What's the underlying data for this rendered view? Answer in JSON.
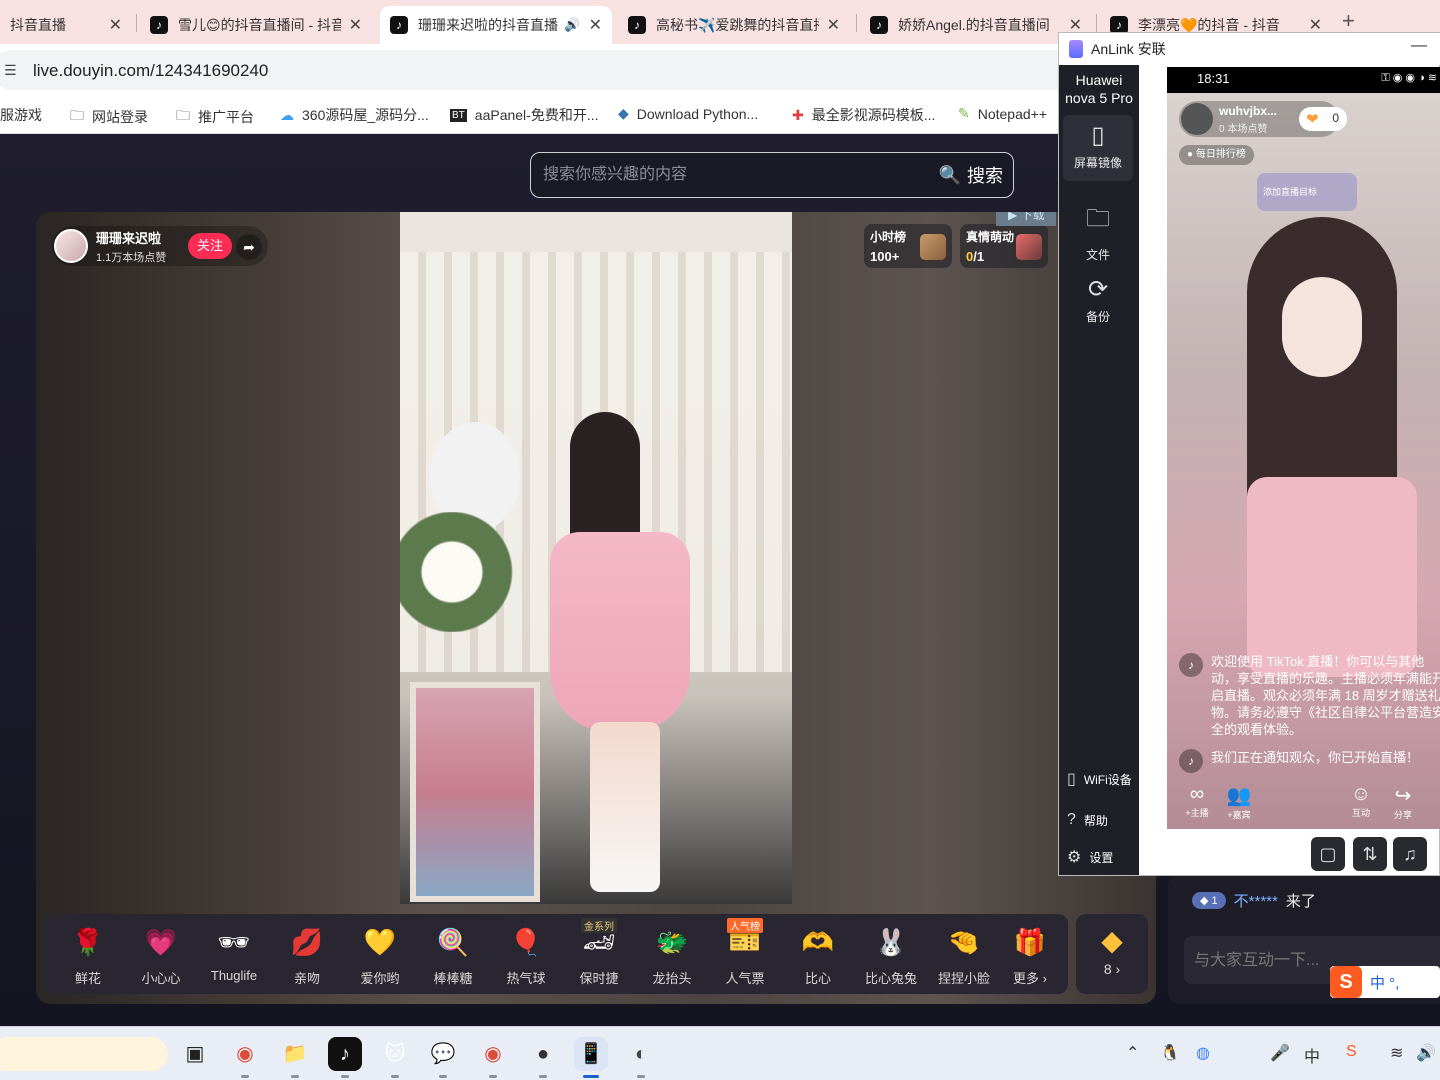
{
  "browser": {
    "tabs": [
      {
        "title": "抖音直播",
        "active": false
      },
      {
        "title": "雪儿😊的抖音直播间 - 抖音",
        "active": false
      },
      {
        "title": "珊珊来迟啦的抖音直播",
        "active": true
      },
      {
        "title": "高秘书✈️爱跳舞的抖音直播",
        "active": false
      },
      {
        "title": "娇娇Angel.的抖音直播间",
        "active": false
      },
      {
        "title": "李漂亮🧡的抖音 - 抖音",
        "active": false
      }
    ],
    "url": "live.douyin.com/124341690240",
    "bookmarks": [
      {
        "label": "服游戏",
        "icon": "folder-icon"
      },
      {
        "label": "网站登录",
        "icon": "folder-icon"
      },
      {
        "label": "推广平台",
        "icon": "folder-icon"
      },
      {
        "label": "360源码屋_源码分...",
        "icon": "cloud-icon"
      },
      {
        "label": "aaPanel-免费和开...",
        "icon": "bt-icon"
      },
      {
        "label": "Download Python...",
        "icon": "python-icon"
      },
      {
        "label": "最全影视源码模板...",
        "icon": "puzzle-icon"
      },
      {
        "label": "Notepad++",
        "icon": "notepad-icon"
      }
    ]
  },
  "search": {
    "placeholder": "搜索你感兴趣的内容",
    "button_label": "搜索"
  },
  "live": {
    "streamer_name": "珊珊来迟啦",
    "streamer_likes": "1.1万本场点赞",
    "follow_label": "关注",
    "hourly_rank_title": "小时榜",
    "hourly_rank_value": "100+",
    "ranking_title": "真情萌动",
    "ranking_value_hl": "0",
    "ranking_value_rest": "/1",
    "download_label": "下载"
  },
  "gifts": [
    {
      "label": "鲜花",
      "icon": "🌹",
      "badge": ""
    },
    {
      "label": "小心心",
      "icon": "💗",
      "badge": ""
    },
    {
      "label": "Thuglife",
      "icon": "🕶",
      "badge": ""
    },
    {
      "label": "亲吻",
      "icon": "💋",
      "badge": ""
    },
    {
      "label": "爱你哟",
      "icon": "💛",
      "badge": ""
    },
    {
      "label": "棒棒糖",
      "icon": "🍭",
      "badge": ""
    },
    {
      "label": "热气球",
      "icon": "🎈",
      "badge": ""
    },
    {
      "label": "保时捷",
      "icon": "🏎",
      "badge": "金系列"
    },
    {
      "label": "龙抬头",
      "icon": "🐲",
      "badge": ""
    },
    {
      "label": "人气票",
      "icon": "🎫",
      "badge": "人气榜"
    },
    {
      "label": "比心",
      "icon": "🫶",
      "badge": ""
    },
    {
      "label": "比心兔兔",
      "icon": "🐰",
      "badge": ""
    },
    {
      "label": "捏捏小脸",
      "icon": "🤏",
      "badge": ""
    },
    {
      "label": "更多 ›",
      "icon": "🎁",
      "badge": ""
    }
  ],
  "diamond": {
    "count": "8 ›"
  },
  "chat": {
    "level": "1",
    "user": "不*****",
    "text": "来了",
    "placeholder": "与大家互动一下..."
  },
  "ime": {
    "text": "中 °,"
  },
  "anlink": {
    "title": "AnLink 安联",
    "device_name_line1": "Huawei",
    "device_name_line2": "nova 5 Pro",
    "side_items": [
      {
        "label": "屏幕镜像",
        "icon": "phone-icon"
      },
      {
        "label": "文件",
        "icon": "folder-icon"
      },
      {
        "label": "备份",
        "icon": "sync-icon"
      }
    ],
    "bottom_items": [
      {
        "label": "WiFi设备",
        "icon": "wifi-device-icon"
      },
      {
        "label": "帮助",
        "icon": "help-icon"
      },
      {
        "label": "设置",
        "icon": "gear-icon"
      }
    ],
    "phone": {
      "time": "18:31",
      "user": "wuhvjbx...",
      "likes": "0 本场点赞",
      "heart_count": "0",
      "rank_label": "每日排行榜",
      "goal_label": "添加直播目标",
      "message_1": "欢迎使用 TikTok 直播！你可以与其他动，享受直播的乐趣。主播必须年满能开启直播。观众必须年满 18 周岁才赠送礼物。请务必遵守《社区自律公平台营造安全的观看体验。",
      "message_2": "我们正在通知观众，你已开始直播！",
      "actions": [
        {
          "label": "+主播",
          "icon": "∞"
        },
        {
          "label": "+嘉宾",
          "icon": "👥"
        },
        {
          "label": "互动",
          "icon": "☺"
        },
        {
          "label": "分享",
          "icon": "↪"
        }
      ]
    }
  },
  "taskbar": {
    "apps": [
      {
        "name": "task-view",
        "icon": "▣"
      },
      {
        "name": "chrome",
        "icon": "◉"
      },
      {
        "name": "file-explorer",
        "icon": "📁"
      },
      {
        "name": "tiktok",
        "icon": "♪"
      },
      {
        "name": "cat-app",
        "icon": "🐱"
      },
      {
        "name": "wechat",
        "icon": "💬"
      },
      {
        "name": "chrome-ai",
        "icon": "◉"
      },
      {
        "name": "obs",
        "icon": "●"
      },
      {
        "name": "anlink",
        "icon": "📱"
      },
      {
        "name": "recorder",
        "icon": "◐"
      }
    ]
  },
  "colors": {
    "accent_red": "#fe2c55",
    "page_bg": "#161724",
    "anlink_sidebar": "#1f1f27"
  }
}
